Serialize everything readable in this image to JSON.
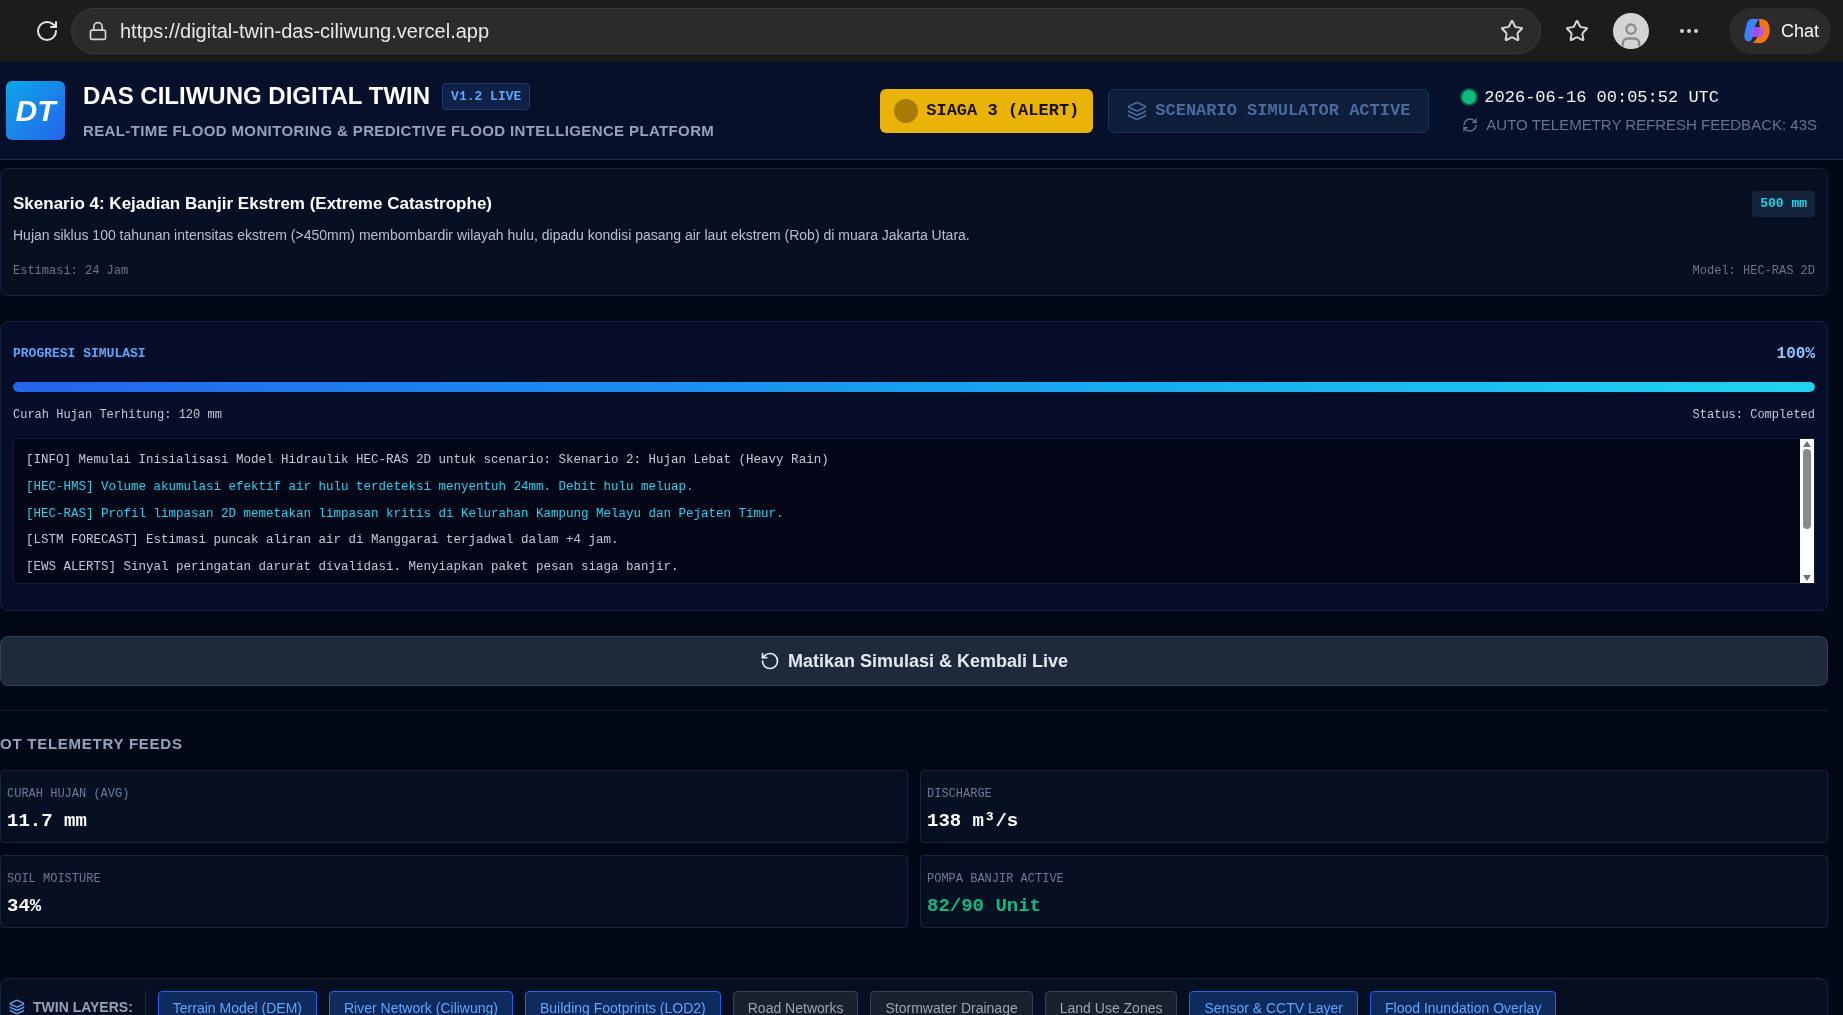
{
  "browser": {
    "url": "https://digital-twin-das-ciliwung.vercel.app",
    "chat_label": "Chat"
  },
  "header": {
    "logo_text": "DT",
    "title": "DAS CILIWUNG DIGITAL TWIN",
    "version_badge": "V1.2 LIVE",
    "subtitle": "REAL-TIME FLOOD MONITORING & PREDICTIVE FLOOD INTELLIGENCE PLATFORM",
    "alert_button": "SIAGA 3 (ALERT)",
    "simulator_badge": "SCENARIO SIMULATOR ACTIVE",
    "online": true,
    "timestamp": "2026-06-16 00:05:52 UTC",
    "refresh_text": "AUTO TELEMETRY REFRESH FEEDBACK: 43S"
  },
  "scenario": {
    "title": "Skenario 4: Kejadian Banjir Ekstrem (Extreme Catastrophe)",
    "badge": "500 mm",
    "description": "Hujan siklus 100 tahunan intensitas ekstrem (>450mm) membombardir wilayah hulu, dipadu kondisi pasang air laut ekstrem (Rob) di muara Jakarta Utara.",
    "estimate": "Estimasi: 24 Jam",
    "model": "Model: HEC-RAS 2D"
  },
  "progress": {
    "label": "PROGRESI SIMULASI",
    "percent": "100%",
    "level": 1,
    "rainfall": "Curah Hujan Terhitung: 120 mm",
    "status": "Status: Completed"
  },
  "log": [
    {
      "kind": "info",
      "text": "[INFO] Memulai Inisialisasi Model Hidraulik HEC-RAS 2D untuk scenario: Skenario 2: Hujan Lebat (Heavy Rain)"
    },
    {
      "kind": "model",
      "text": "[HEC-HMS] Volume akumulasi efektif air hulu terdeteksi menyentuh 24mm. Debit hulu meluap."
    },
    {
      "kind": "model",
      "text": "[HEC-RAS] Profil limpasan 2D memetakan limpasan kritis di Kelurahan Kampung Melayu dan Pejaten Timur."
    },
    {
      "kind": "info",
      "text": "[LSTM FORECAST] Estimasi puncak aliran air di Manggarai terjadwal dalam +4 jam."
    },
    {
      "kind": "info",
      "text": "[EWS ALERTS] Sinyal peringatan darurat divalidasi. Menyiapkan paket pesan siaga banjir."
    }
  ],
  "stop_button": "Matikan Simulasi & Kembali Live",
  "telemetry": {
    "title": "OT TELEMETRY FEEDS",
    "cards": [
      {
        "label": "CURAH HUJAN (AVG)",
        "value": "11.7 mm",
        "kind": "normal"
      },
      {
        "label": "DISCHARGE",
        "value": "138 m³/s",
        "kind": "normal"
      },
      {
        "label": "SOIL MOISTURE",
        "value": "34%",
        "kind": "normal"
      },
      {
        "label": "POMPA BANJIR ACTIVE",
        "value": "82/90 Unit",
        "kind": "ok"
      }
    ]
  },
  "layers": {
    "label": "TWIN LAYERS:",
    "items": [
      {
        "label": "Terrain Model (DEM)",
        "selected": true
      },
      {
        "label": "River Network (Ciliwung)",
        "selected": true
      },
      {
        "label": "Building Footprints (LOD2)",
        "selected": true
      },
      {
        "label": "Road Networks",
        "selected": false
      },
      {
        "label": "Stormwater Drainage",
        "selected": false
      },
      {
        "label": "Land Use Zones",
        "selected": false
      },
      {
        "label": "Sensor & CCTV Layer",
        "selected": true
      },
      {
        "label": "Flood Inundation Overlay",
        "selected": true
      }
    ]
  }
}
